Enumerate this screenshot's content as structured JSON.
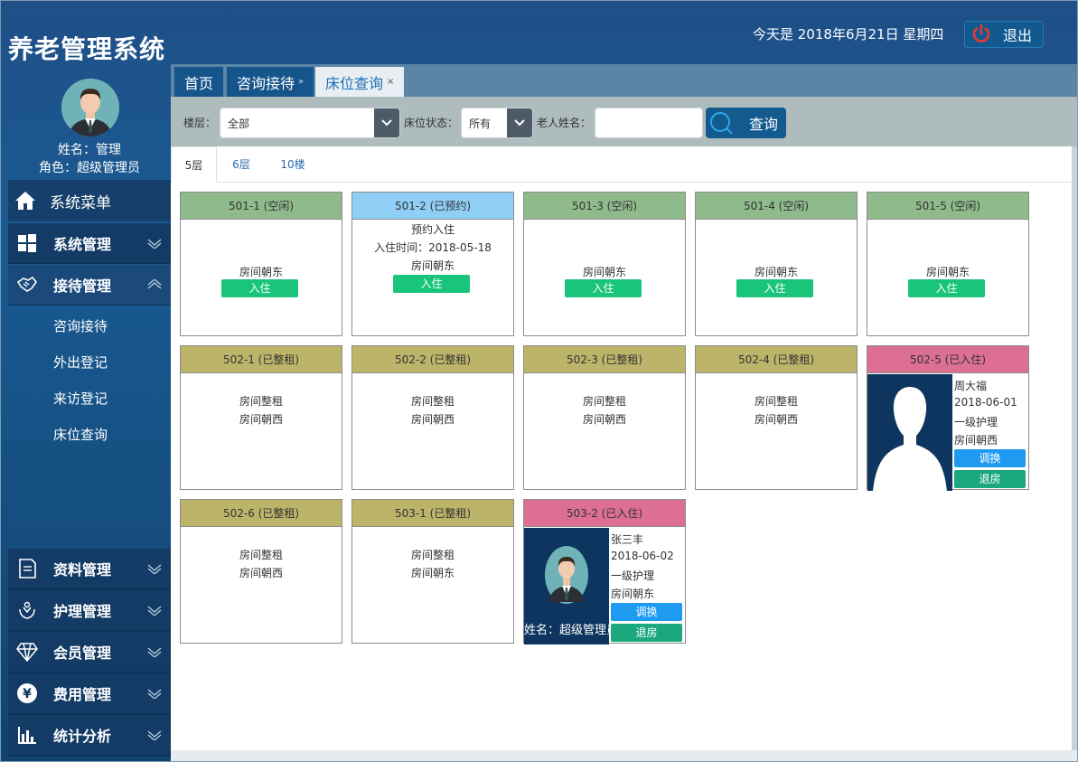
{
  "app": {
    "title": "养老管理系统"
  },
  "header": {
    "date_text": "今天是 2018年6月21日 星期四",
    "logout_label": "退出"
  },
  "user": {
    "name_line": "姓名：管理",
    "role_line": "角色：超级管理员"
  },
  "sidebar": {
    "menu_title": "系统菜单",
    "items": [
      {
        "label": "系统管理",
        "icon": "windows-icon"
      },
      {
        "label": "接待管理",
        "icon": "handshake-icon"
      },
      {
        "label": "资料管理",
        "icon": "document-icon"
      },
      {
        "label": "护理管理",
        "icon": "care-hands-icon"
      },
      {
        "label": "会员管理",
        "icon": "diamond-icon"
      },
      {
        "label": "费用管理",
        "icon": "yen-icon"
      },
      {
        "label": "统计分析",
        "icon": "bar-chart-icon"
      }
    ],
    "submenu": [
      "咨询接待",
      "外出登记",
      "来访登记",
      "床位查询"
    ]
  },
  "tabs": [
    {
      "label": "首页"
    },
    {
      "label": "咨询接待",
      "close": "»"
    },
    {
      "label": "床位查询",
      "close": "×"
    }
  ],
  "filters": {
    "floor_label": "楼层：",
    "floor_value": "全部",
    "status_label": "床位状态：",
    "status_value": "所有",
    "name_label": "老人姓名：",
    "name_value": "",
    "query_label": "查询"
  },
  "floor_tabs": [
    "5层",
    "6层",
    "10楼"
  ],
  "rooms": [
    {
      "title": "501-1 (空闲)",
      "status": "free",
      "lines": [
        "房间朝东"
      ],
      "button": "入住"
    },
    {
      "title": "501-2 (已预约)",
      "status": "reserved",
      "lines": [
        "预约入住",
        "入住时间：2018-05-18",
        "房间朝东"
      ],
      "button": "入住"
    },
    {
      "title": "501-3 (空闲)",
      "status": "free",
      "lines": [
        "房间朝东"
      ],
      "button": "入住"
    },
    {
      "title": "501-4 (空闲)",
      "status": "free",
      "lines": [
        "房间朝东"
      ],
      "button": "入住"
    },
    {
      "title": "501-5 (空闲)",
      "status": "free",
      "lines": [
        "房间朝东"
      ],
      "button": "入住"
    },
    {
      "title": "502-1 (已整租)",
      "status": "rented",
      "lines": [
        "房间整租",
        "房间朝西"
      ]
    },
    {
      "title": "502-2 (已整租)",
      "status": "rented",
      "lines": [
        "房间整租",
        "房间朝西"
      ]
    },
    {
      "title": "502-3 (已整租)",
      "status": "rented",
      "lines": [
        "房间整租",
        "房间朝西"
      ]
    },
    {
      "title": "502-4 (已整租)",
      "status": "rented",
      "lines": [
        "房间整租",
        "房间朝西"
      ]
    },
    {
      "title": "502-5 (已入住)",
      "status": "occupied",
      "occupant": "周大福",
      "date": "2018-06-01",
      "care": "一级护理",
      "orientation": "房间朝西",
      "photo_caption": "",
      "swap": "调换",
      "checkout": "退房"
    },
    {
      "title": "502-6 (已整租)",
      "status": "rented",
      "lines": [
        "房间整租",
        "房间朝西"
      ]
    },
    {
      "title": "503-1 (已整租)",
      "status": "rented",
      "lines": [
        "房间整租",
        "房间朝东"
      ]
    },
    {
      "title": "503-2 (已入住)",
      "status": "occupied",
      "occupant": "张三丰",
      "date": "2018-06-02",
      "care": "一级护理",
      "orientation": "房间朝东",
      "photo_caption": "姓名：超级管理员",
      "swap": "调换",
      "checkout": "退房"
    }
  ],
  "colors": {
    "free": "#8fbb8c",
    "reserved": "#8fcff5",
    "rented": "#bcb569",
    "occupied": "#dd6f92",
    "checkin": "#19c47b",
    "swap": "#1e9bf0",
    "checkout": "#1aa87c"
  }
}
